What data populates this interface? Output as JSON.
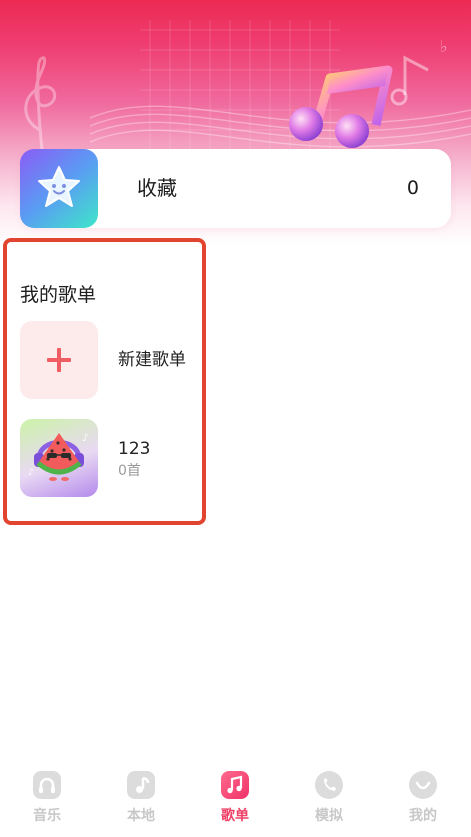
{
  "favorites": {
    "label": "收藏",
    "count": "0",
    "icon": "star-face-icon"
  },
  "my_playlists": {
    "title": "我的歌单",
    "new_playlist_label": "新建歌单",
    "items": [
      {
        "name": "123",
        "track_count": "0首",
        "cover": "watermelon-headphones-icon"
      }
    ]
  },
  "bottom_nav": {
    "items": [
      {
        "label": "音乐",
        "icon": "music-headphones-icon",
        "active": false
      },
      {
        "label": "本地",
        "icon": "local-music-icon",
        "active": false
      },
      {
        "label": "歌单",
        "icon": "playlist-note-icon",
        "active": true
      },
      {
        "label": "模拟",
        "icon": "phone-icon",
        "active": false
      },
      {
        "label": "我的",
        "icon": "profile-icon",
        "active": false
      }
    ]
  },
  "colors": {
    "accent": "#ee3f66",
    "highlight_border": "#e2452f",
    "banner_top": "#ec2a54",
    "new_playlist_bg": "#fdebec",
    "plus": "#ef5d62"
  }
}
